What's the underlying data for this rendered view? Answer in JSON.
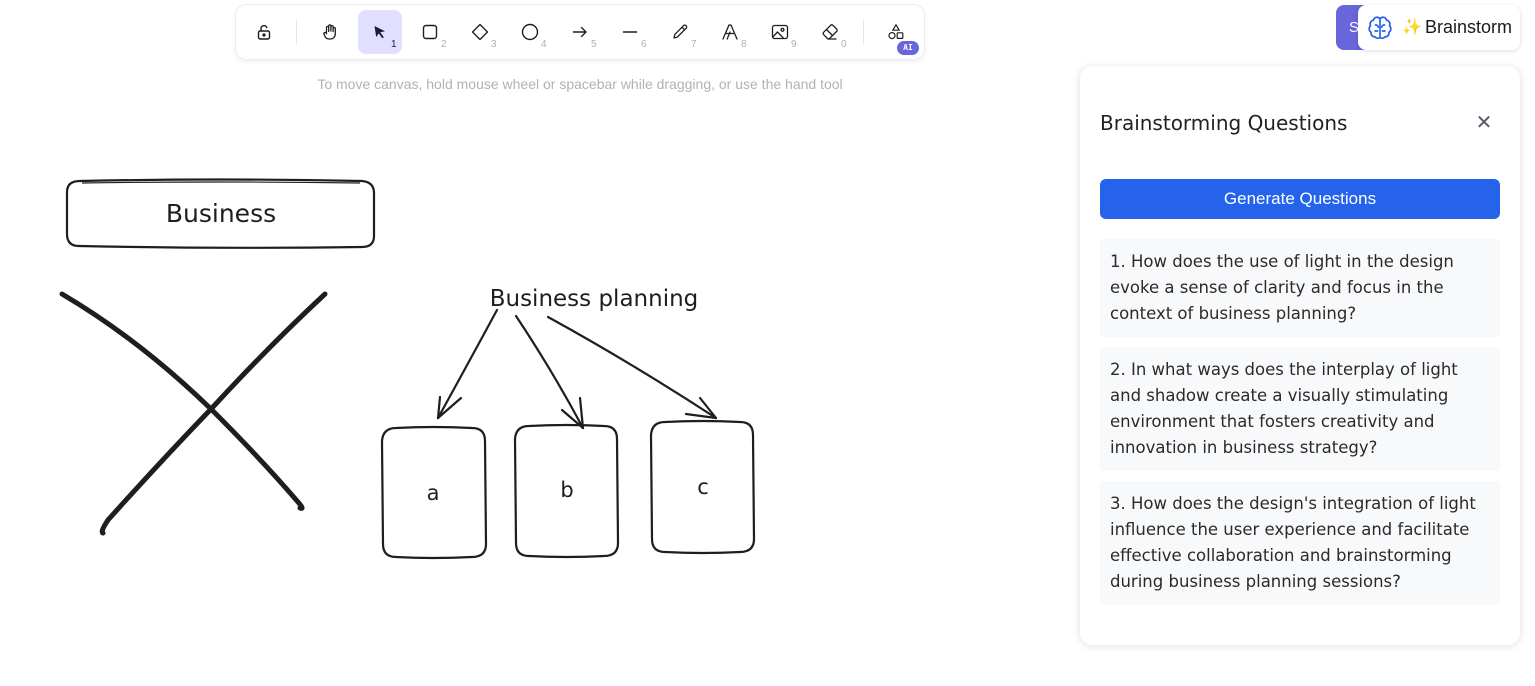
{
  "toolbar": {
    "tools": [
      {
        "name": "lock",
        "key": ""
      },
      {
        "name": "hand",
        "key": ""
      },
      {
        "name": "selection",
        "key": "1"
      },
      {
        "name": "rectangle",
        "key": "2"
      },
      {
        "name": "diamond",
        "key": "3"
      },
      {
        "name": "ellipse",
        "key": "4"
      },
      {
        "name": "arrow",
        "key": "5"
      },
      {
        "name": "line",
        "key": "6"
      },
      {
        "name": "draw",
        "key": "7"
      },
      {
        "name": "text",
        "key": "8"
      },
      {
        "name": "image",
        "key": "9"
      },
      {
        "name": "eraser",
        "key": "0"
      },
      {
        "name": "more-shapes",
        "key": ""
      }
    ],
    "active_tool": "selection",
    "ai_badge": "AI"
  },
  "hint": "To move canvas, hold mouse wheel or spacebar while dragging, or use the hand tool",
  "share_button": {
    "label": "S"
  },
  "brainstorm_button": {
    "icon": "brain-icon",
    "sparkle": "✨",
    "label": "Brainstorm"
  },
  "panel": {
    "title": "Brainstorming Questions",
    "close": "✕",
    "generate_label": "Generate Questions",
    "questions": [
      "1. How does the use of light in the design evoke a sense of clarity and focus in the context of business planning?",
      "2. In what ways does the interplay of light and shadow create a visually stimulating environment that fosters creativity and innovation in business strategy?",
      "3. How does the design's integration of light influence the user experience and facilitate effective collaboration and brainstorming during business planning sessions?"
    ]
  },
  "canvas": {
    "business_box": "Business",
    "planning_label": "Business planning",
    "children": [
      "a",
      "b",
      "c"
    ]
  },
  "colors": {
    "accent": "#6965db",
    "active_tool_bg": "#e0dfff",
    "generate_button": "#2563eb",
    "stroke": "#1e1e1e"
  }
}
